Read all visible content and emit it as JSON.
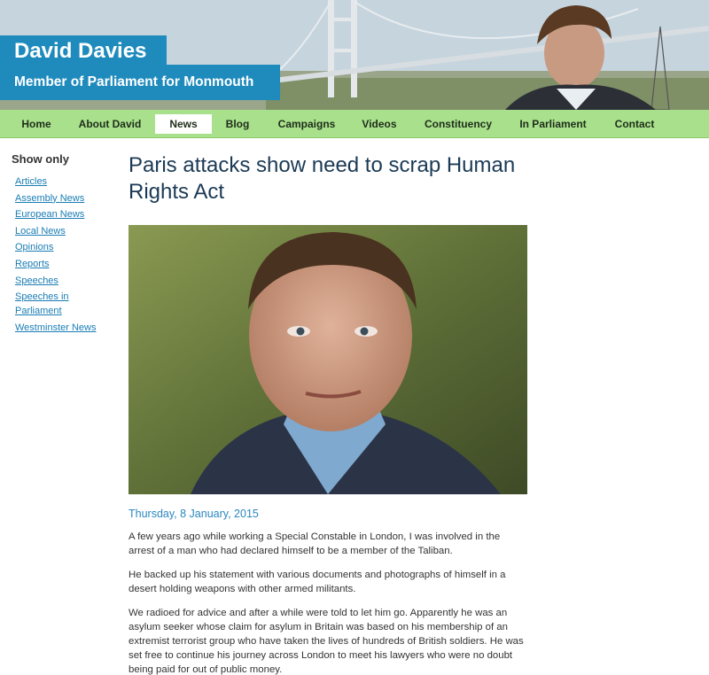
{
  "site": {
    "name": "David Davies",
    "tagline": "Member of Parliament for Monmouth"
  },
  "nav": {
    "items": [
      {
        "label": "Home"
      },
      {
        "label": "About David"
      },
      {
        "label": "News"
      },
      {
        "label": "Blog"
      },
      {
        "label": "Campaigns"
      },
      {
        "label": "Videos"
      },
      {
        "label": "Constituency"
      },
      {
        "label": "In Parliament"
      },
      {
        "label": "Contact"
      }
    ],
    "active": "News"
  },
  "sidebar": {
    "heading": "Show only",
    "links": [
      "Articles",
      "Assembly News",
      "European News",
      "Local News",
      "Opinions",
      "Reports",
      "Speeches",
      "Speeches in Parliament",
      "Westminster News"
    ]
  },
  "article": {
    "title": "Paris attacks show need to scrap Human Rights Act",
    "date": "Thursday, 8 January, 2015",
    "paragraphs": [
      "A few years ago while working a Special Constable in London, I was involved in the arrest of a man who had declared himself to be a member of the Taliban.",
      "He backed up his statement with various documents and photographs of himself in a desert holding weapons with other armed militants.",
      "We radioed for advice and after a while were told to let him go. Apparently he was an asylum seeker whose claim for asylum in Britain was based on his membership of an extremist terrorist group who have taken the lives of hundreds of British soldiers. He was set free to continue his journey across London to meet his lawyers who were no doubt being paid for out of public money."
    ]
  },
  "colors": {
    "brand_blue": "#1f8bbd",
    "nav_green": "#a8e08c",
    "link_blue": "#1a7db4"
  }
}
